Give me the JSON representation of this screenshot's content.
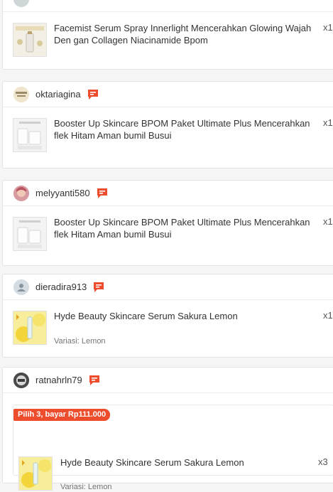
{
  "orders": [
    {
      "items": [
        {
          "title": "Facemist Serum Spray Innerlight Mencerahkan Glowing Wajah Den gan Collagen Niacinamide Bpom",
          "qty": "x1"
        }
      ]
    },
    {
      "username": "oktariagina",
      "avatar_icon": "avatar-photo-icon",
      "items": [
        {
          "title": "Booster Up Skincare BPOM Paket Ultimate Plus Mencerahkan flek Hitam Aman bumil Busui",
          "qty": "x1"
        }
      ]
    },
    {
      "username": "melyyanti580",
      "avatar_icon": "avatar-photo-icon",
      "items": [
        {
          "title": "Booster Up Skincare BPOM Paket Ultimate Plus Mencerahkan flek Hitam Aman bumil Busui",
          "qty": "x1"
        }
      ]
    },
    {
      "username": "dieradira913",
      "avatar_icon": "default-user-icon",
      "items": [
        {
          "title": "Hyde Beauty Skincare Serum Sakura Lemon",
          "qty": "x1",
          "variant": "Variasi: Lemon"
        }
      ]
    },
    {
      "username": "ratnahrln79",
      "avatar_icon": "avatar-photo-icon",
      "promo": "Pilih 3, bayar Rp111.000",
      "items": [
        {
          "title": "Hyde Beauty Skincare Serum Sakura Lemon",
          "qty": "x3",
          "variant": "Variasi: Lemon"
        }
      ]
    }
  ],
  "colors": {
    "accent": "#ee4d2d",
    "border": "#e3e3e3",
    "background": "#f5f5f5"
  },
  "icons": {
    "chat": "chat-bubble-icon"
  }
}
